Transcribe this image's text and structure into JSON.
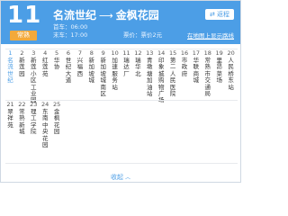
{
  "header": {
    "route_number": "11",
    "badge": "常熟",
    "start_station": "名流世纪",
    "arrow": "⟶",
    "end_station": "金枫花园",
    "reverse_label": "返程",
    "first_bus": "首车：06:00",
    "last_bus": "末车：17:00",
    "fare": "票价：票价2元",
    "map_link": "在地图上显示路线"
  },
  "stops": [
    {
      "num": "1",
      "name": "名流世纪"
    },
    {
      "num": "2",
      "name": "新莲园"
    },
    {
      "num": "3",
      "name": "新莲小区工业园"
    },
    {
      "num": "4",
      "name": "红莲苑"
    },
    {
      "num": "5",
      "name": "华协"
    },
    {
      "num": "6",
      "name": "世纪大道"
    },
    {
      "num": "7",
      "name": "兴福西"
    },
    {
      "num": "8",
      "name": "新加坡城"
    },
    {
      "num": "9",
      "name": "新加坡城南区"
    },
    {
      "num": "10",
      "name": "加速服务站"
    },
    {
      "num": "11",
      "name": "瑞达厂"
    },
    {
      "num": "12",
      "name": "瑞华北"
    },
    {
      "num": "13",
      "name": "青墩塘加油站"
    },
    {
      "num": "14",
      "name": "印象城购物广场"
    },
    {
      "num": "15",
      "name": "第二人民医院"
    },
    {
      "num": "16",
      "name": "市政府"
    },
    {
      "num": "17",
      "name": "华联商城"
    },
    {
      "num": "18",
      "name": "常熟市交通局"
    },
    {
      "num": "19",
      "name": "里昂菜场"
    },
    {
      "num": "20",
      "name": "人民桥东站"
    },
    {
      "num": "21",
      "name": "翠祥苑"
    },
    {
      "num": "22",
      "name": "常熟新城"
    },
    {
      "num": "23",
      "name": "理工学院"
    },
    {
      "num": "24",
      "name": "东南中央花园"
    },
    {
      "num": "25",
      "name": "金枫花园"
    }
  ],
  "footer": {
    "collapse_label": "收起",
    "collapse_icon": "chevron-up"
  },
  "colors": {
    "header_bg": "#4c9ee6",
    "badge_bg": "#f3a93a",
    "accent": "#4c9ee6"
  }
}
